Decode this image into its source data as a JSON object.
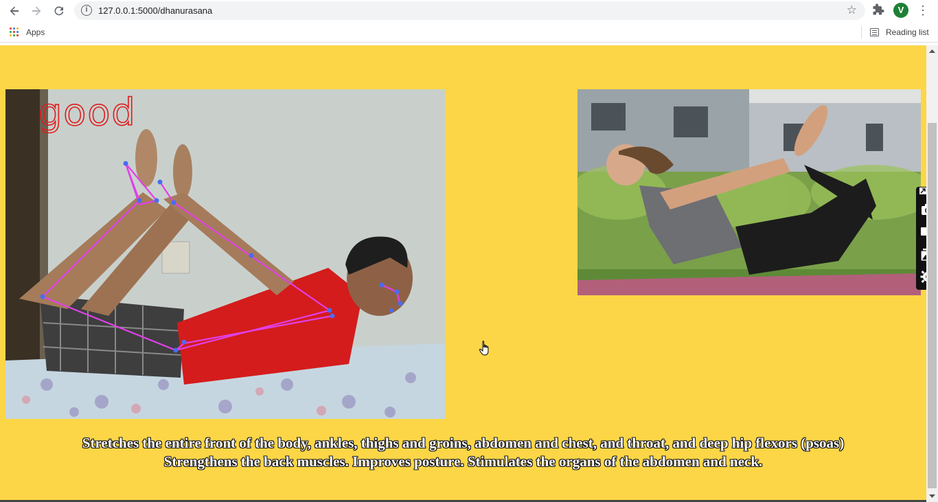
{
  "browser": {
    "url": "127.0.0.1:5000/dhanurasana",
    "avatar_letter": "V",
    "bookmarks": {
      "apps_label": "Apps",
      "reading_list_label": "Reading list"
    },
    "icons": [
      "back-icon",
      "forward-icon",
      "reload-icon",
      "info-icon",
      "star-icon",
      "puzzle-icon",
      "kebab-menu-icon"
    ]
  },
  "page": {
    "background_color": "#fcd647",
    "camera_feed": {
      "status": "good",
      "status_color": "#e01a1a",
      "skeleton_color": "#e040e8",
      "joint_color": "#4a6cf0"
    },
    "reference_image": {
      "description_visible": false
    },
    "description": {
      "line1": "Stretches the entire front of the body, ankles, thighs and groins, abdomen and chest, and throat, and deep hip flexors (psoas)",
      "line2": "Strengthens the back muscles. Improves posture. Stimulates the organs of the abdomen and neck."
    }
  },
  "side_widget": {
    "icons": [
      "pin-icon",
      "camera-icon",
      "video-icon",
      "gallery-icon",
      "settings-icon"
    ]
  }
}
